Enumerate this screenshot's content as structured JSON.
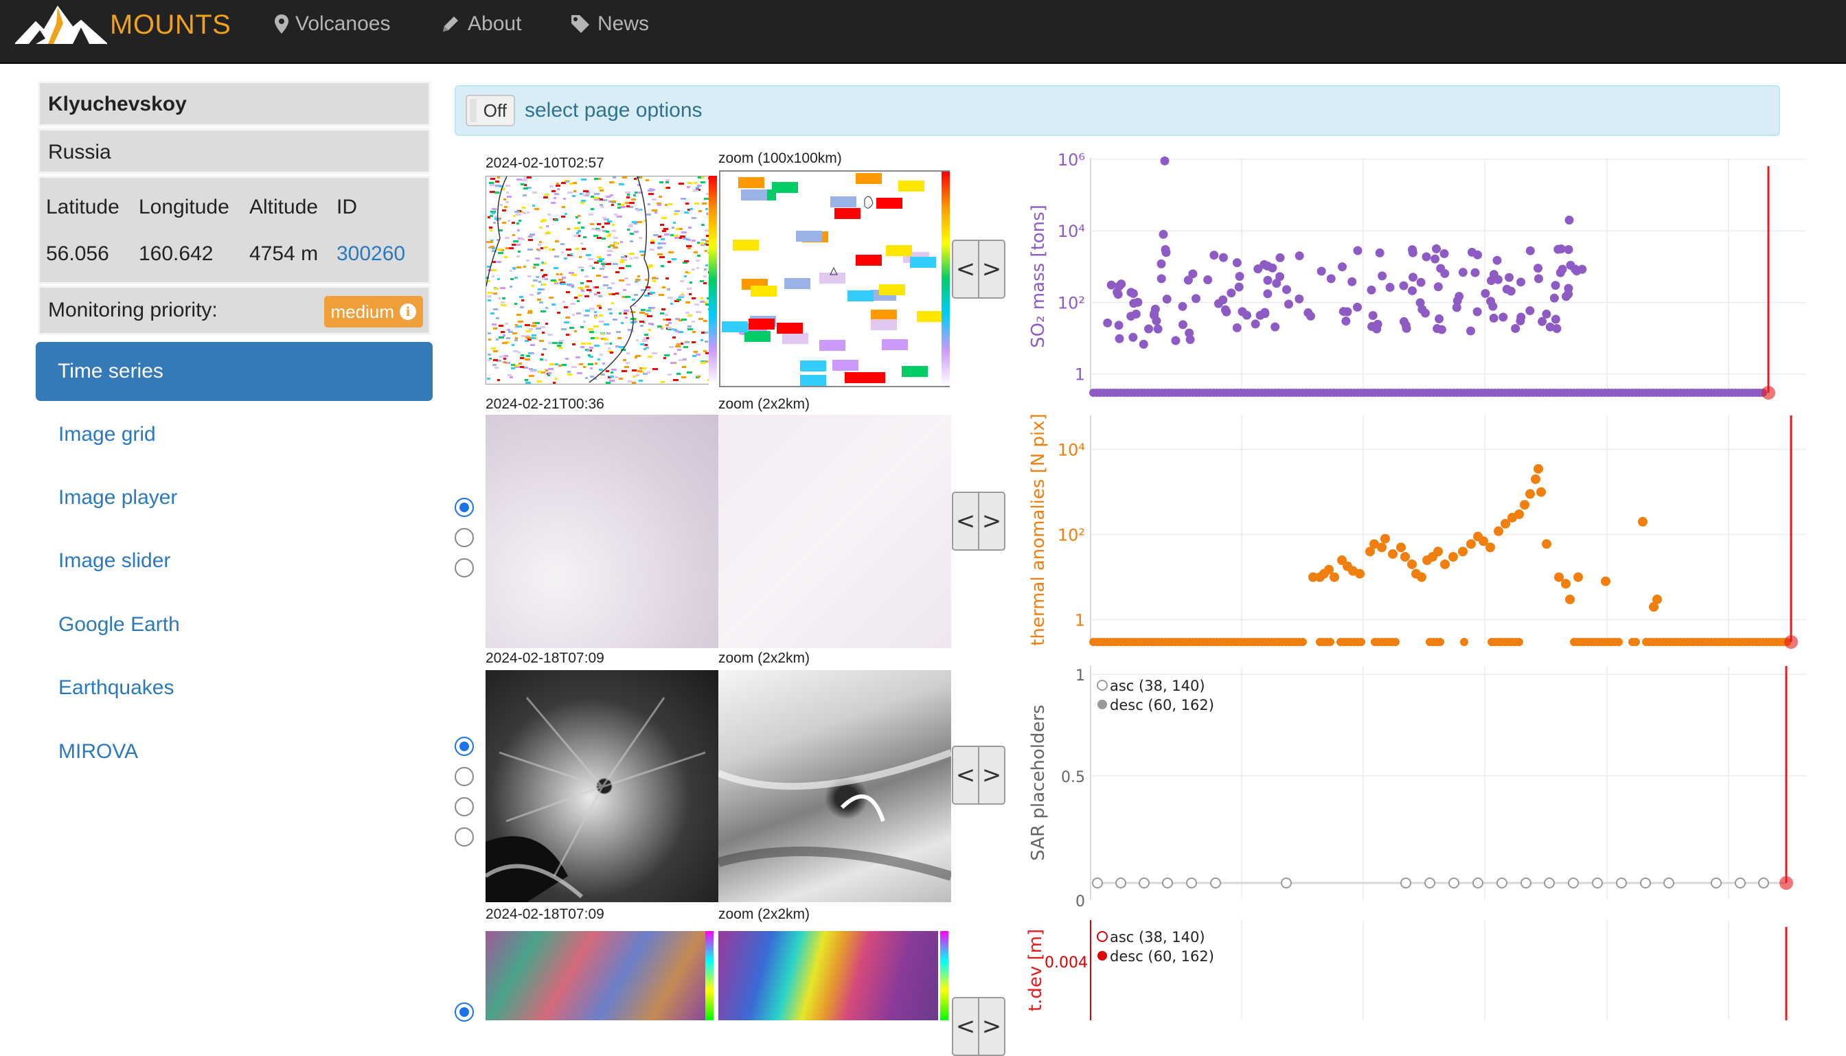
{
  "navbar": {
    "brand": "MOUNTS",
    "items": [
      {
        "id": "volcanoes",
        "label": "Volcanoes",
        "icon": "map-marker-icon"
      },
      {
        "id": "about",
        "label": "About",
        "icon": "pencil-icon"
      },
      {
        "id": "news",
        "label": "News",
        "icon": "tag-icon"
      }
    ]
  },
  "volcano": {
    "name": "Klyuchevskoy",
    "country": "Russia",
    "headers": {
      "lat": "Latitude",
      "lon": "Longitude",
      "alt": "Altitude",
      "id": "ID"
    },
    "latitude": "56.056",
    "longitude": "160.642",
    "altitude": "4754 m",
    "id": "300260",
    "priority_label": "Monitoring priority:",
    "priority_value": "medium"
  },
  "menu": {
    "active": "Time series",
    "items": [
      "Image grid",
      "Image player",
      "Image slider",
      "Google Earth",
      "Earthquakes",
      "MIROVA"
    ]
  },
  "options": {
    "toggle": "Off",
    "text": "select page options"
  },
  "panels": [
    {
      "date": "2024-02-10T02:57",
      "zoom": "zoom (100x100km)"
    },
    {
      "date": "2024-02-21T00:36",
      "zoom": "zoom (2x2km)"
    },
    {
      "date": "2024-02-18T07:09",
      "zoom": "zoom (2x2km)"
    },
    {
      "date": "2024-02-18T07:09",
      "zoom": "zoom (2x2km)"
    }
  ],
  "nav_buttons": {
    "prev": "<",
    "next": ">"
  },
  "colors": {
    "so2": "#8e5bc5",
    "thermal": "#f07f0e",
    "sar": "#7f7f7f",
    "marker": "#e41a1c",
    "link": "#2a79bd",
    "brand": "#f0a21d"
  },
  "chart_data": [
    {
      "type": "scatter",
      "ylabel": "SO₂ mass [tons]",
      "yscale": "log",
      "ylim": [
        0.3,
        1000000
      ],
      "ytick_labels": [
        "1",
        "10²",
        "10⁴",
        "10⁶"
      ],
      "series": [
        {
          "values_baseline": 0.3,
          "values": [
            900000,
            7000,
            3000,
            1500,
            800,
            600,
            500,
            400,
            300,
            250,
            200,
            180,
            150,
            120,
            100,
            90,
            80,
            70,
            60,
            50,
            40,
            30,
            20,
            4000,
            20000
          ]
        }
      ]
    },
    {
      "type": "scatter",
      "ylabel": "thermal anomalies [N pix]",
      "yscale": "log",
      "ylim": [
        0.3,
        30000
      ],
      "ytick_labels": [
        "1",
        "10²",
        "10⁴"
      ],
      "series": [
        {
          "values_baseline": 0.3,
          "values": [
            10,
            12,
            15,
            20,
            30,
            40,
            60,
            80,
            100,
            150,
            200,
            300,
            500,
            1000,
            2000,
            3000,
            5000,
            60,
            10,
            3,
            200,
            2,
            8
          ]
        }
      ]
    },
    {
      "type": "scatter",
      "ylabel": "SAR placeholders",
      "ylim": [
        0,
        1
      ],
      "ytick_labels": [
        "0",
        "0.5",
        "1"
      ],
      "legend": [
        "asc (38, 140)",
        "desc (60, 162)"
      ],
      "legend_position": "top-left"
    },
    {
      "type": "scatter",
      "ylabel": "t.dev [m]",
      "ytick_labels": [
        "0.004"
      ],
      "legend": [
        "asc (38, 140)",
        "desc (60, 162)"
      ],
      "legend_position": "top-left"
    }
  ]
}
